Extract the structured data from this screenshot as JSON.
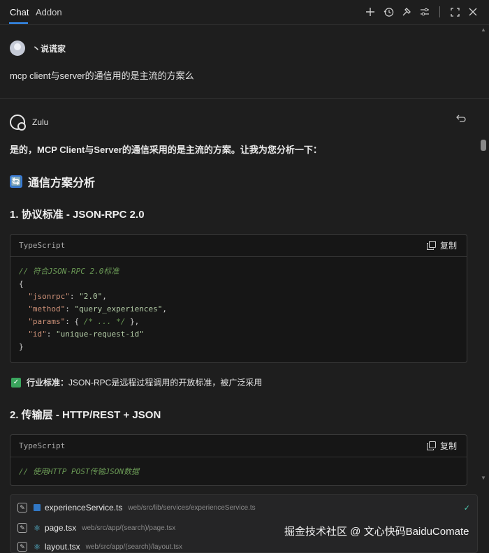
{
  "tabs": [
    {
      "label": "Chat",
      "active": true
    },
    {
      "label": "Addon",
      "active": false
    }
  ],
  "toolbar_icons": [
    "plus-icon",
    "history-icon",
    "hammer-icon",
    "sliders-icon",
    "expand-icon",
    "close-icon"
  ],
  "user": {
    "name": "丶说谎家",
    "question": "mcp client与server的通信用的是主流的方案么"
  },
  "bot": {
    "name": "Zulu",
    "intro": "是的，MCP Client与Server的通信采用的是主流的方案。让我为您分析一下："
  },
  "answer": {
    "heading": "通信方案分析",
    "heading_emoji": "🔄",
    "section1": "1. 协议标准 - JSON-RPC 2.0",
    "code1": {
      "lang": "TypeScript",
      "copy": "复制",
      "comment": "// 符合JSON-RPC 2.0标准",
      "open": "{",
      "lines": [
        {
          "key": "\"jsonrpc\"",
          "sep": ": ",
          "val": "\"2.0\"",
          "end": ","
        },
        {
          "key": "\"method\"",
          "sep": ": ",
          "val": "\"query_experiences\"",
          "end": ","
        },
        {
          "key": "\"params\"",
          "sep": ": { ",
          "val": "/* ... */",
          "end": " },"
        },
        {
          "key": "\"id\"",
          "sep": ": ",
          "val": "\"unique-request-id\"",
          "end": ""
        }
      ],
      "close": "}"
    },
    "note_label": "行业标准：",
    "note_text": "JSON-RPC是远程过程调用的开放标准，被广泛采用",
    "section2": "2. 传输层 - HTTP/REST + JSON",
    "code2": {
      "lang": "TypeScript",
      "copy": "复制",
      "comment": "// 使用HTTP POST传输JSON数据"
    }
  },
  "files": [
    {
      "name": "experienceService.ts",
      "path": "web/src/lib/services/experienceService.ts",
      "type": "ts"
    },
    {
      "name": "page.tsx",
      "path": "web/src/app/(search)/page.tsx",
      "type": "react"
    },
    {
      "name": "layout.tsx",
      "path": "web/src/app/(search)/layout.tsx",
      "type": "react"
    }
  ],
  "watermark": "掘金技术社区 @ 文心快码BaiduComate"
}
